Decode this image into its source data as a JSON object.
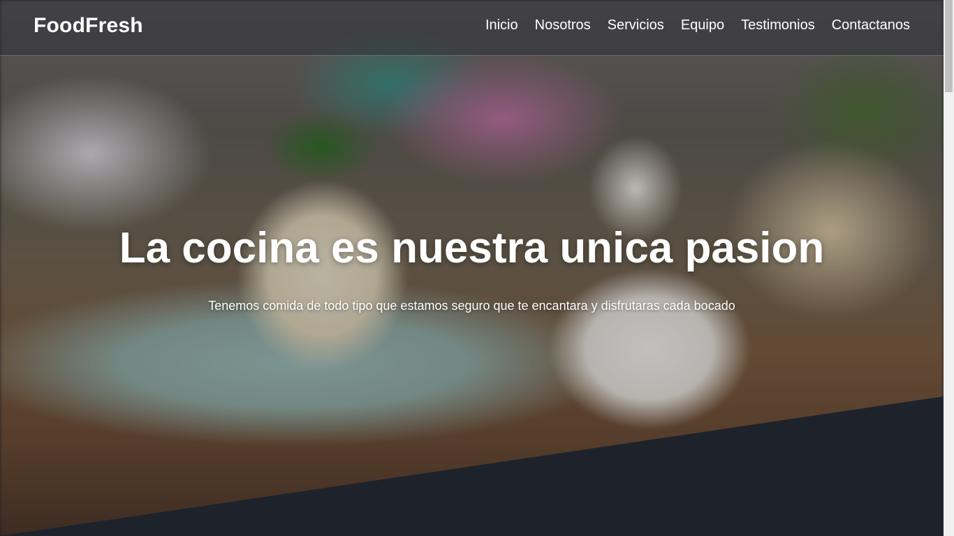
{
  "brand": {
    "name": "FoodFresh"
  },
  "nav": {
    "items": [
      {
        "label": "Inicio"
      },
      {
        "label": "Nosotros"
      },
      {
        "label": "Servicios"
      },
      {
        "label": "Equipo"
      },
      {
        "label": "Testimonios"
      },
      {
        "label": "Contactanos"
      }
    ]
  },
  "hero": {
    "title": "La cocina es nuestra unica pasion",
    "subtitle": "Tenemos comida de todo tipo que estamos seguro que te encantara y disfrutaras cada bocado"
  },
  "colors": {
    "section_dark": "#1e232b",
    "text": "#ffffff"
  }
}
